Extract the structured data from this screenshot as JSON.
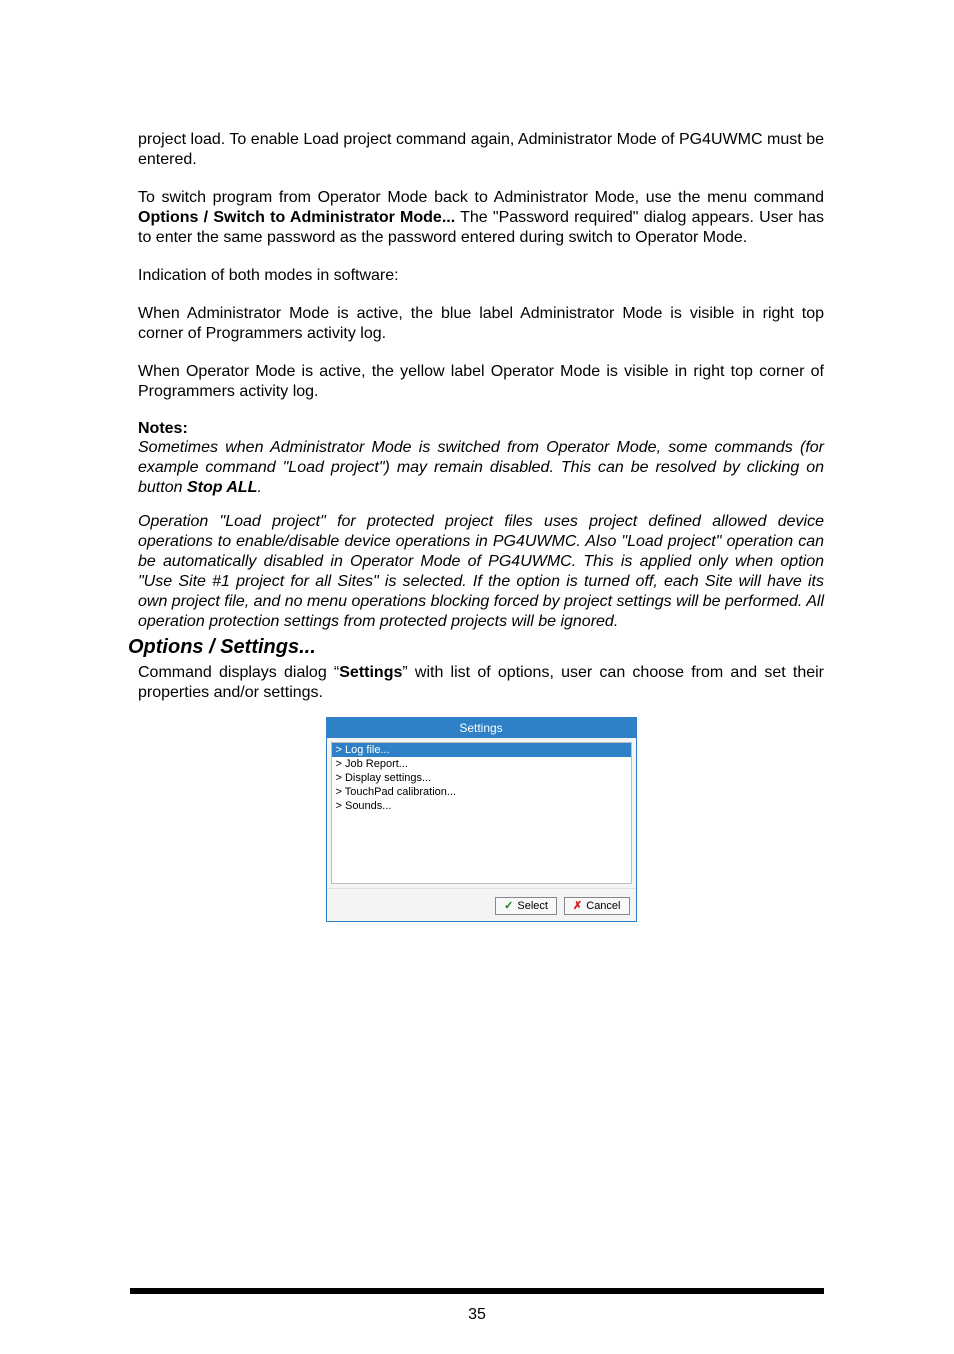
{
  "paragraphs": {
    "p1": "project load. To enable Load project command again, Administrator Mode of PG4UWMC must be entered.",
    "p2_pre": "To switch program from Operator Mode back to Administrator Mode, use the menu command ",
    "p2_bold": "Options / Switch to Administrator Mode...",
    "p2_post": " The \"Password required\" dialog appears. User has to enter the same password as the password entered during switch to Operator Mode.",
    "p3": "Indication of both modes in software:",
    "p4": "When Administrator Mode is active, the blue label Administrator Mode is visible in right top corner of Programmers activity log.",
    "p5": "When Operator Mode is active, the yellow label Operator Mode is visible in right top corner of Programmers activity log.",
    "notes_label": "Notes:",
    "notes1_pre": "Sometimes when Administrator Mode is switched from Operator Mode, some commands (for example command \"Load project\") may remain disabled. This can be resolved by clicking on button ",
    "notes1_bold": "Stop ALL",
    "notes1_post": ".",
    "notes2": "Operation \"Load project\" for protected project files uses project defined allowed device operations to enable/disable device operations in PG4UWMC. Also \"Load project\" operation can be automatically disabled in Operator Mode of PG4UWMC. This is applied only when option \"Use Site #1 project for all Sites\" is selected. If the option is turned off, each Site will have its own project file, and no menu operations blocking forced by project settings will be performed. All operation protection settings from protected projects will be ignored.",
    "section_title": "Options / Settings...",
    "after_title_pre": "Command displays dialog “",
    "after_title_bold": "Settings",
    "after_title_post": "” with list of options, user can choose from and set their properties and/or settings."
  },
  "dialog": {
    "title": "Settings",
    "items": [
      "> Log file...",
      "> Job Report...",
      "> Display settings...",
      "> TouchPad calibration...",
      "> Sounds..."
    ],
    "select_label": "Select",
    "cancel_label": "Cancel"
  },
  "page_number": "35"
}
